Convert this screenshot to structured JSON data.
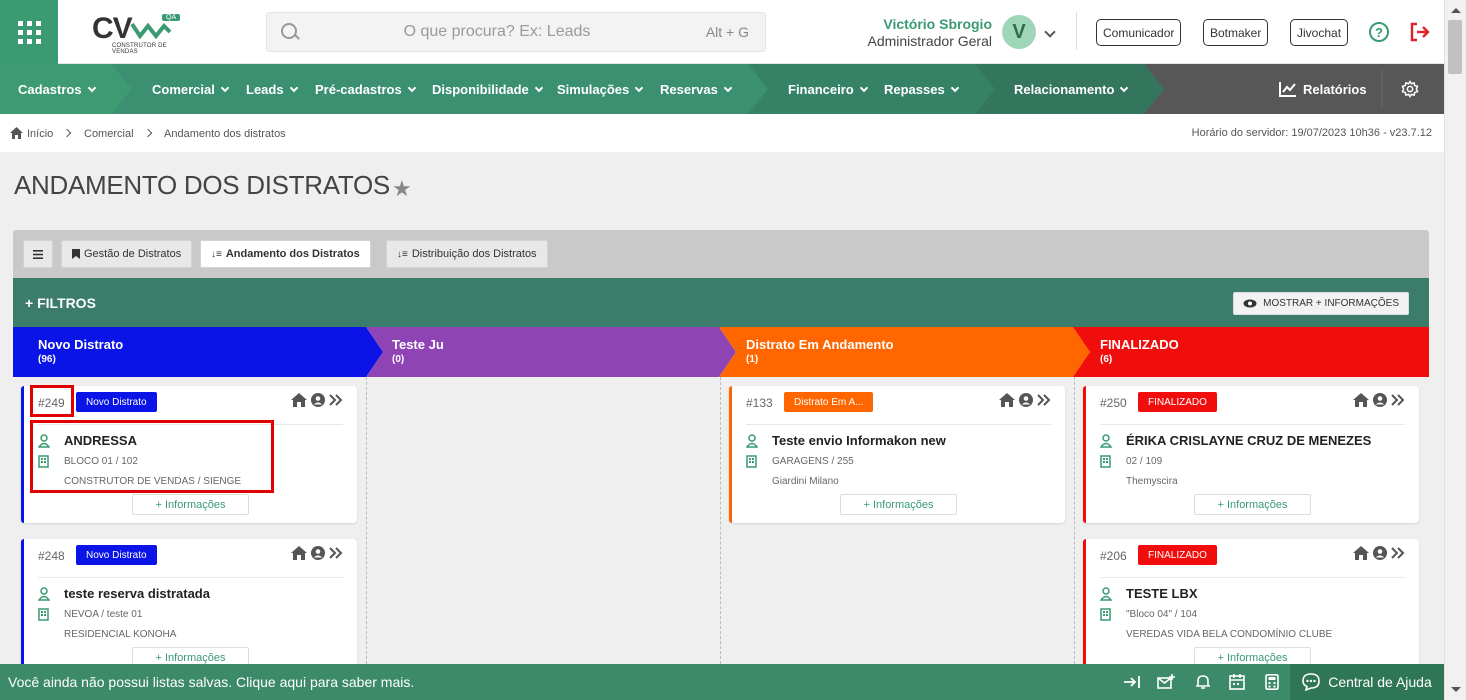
{
  "header": {
    "logo_text": "CV",
    "logo_badge": "QA",
    "logo_sub": "CONSTRUTOR DE VENDAS",
    "search_placeholder": "O que procura? Ex: Leads",
    "search_shortcut": "Alt + G",
    "user_name": "Victório Sbrogio",
    "user_role": "Administrador Geral",
    "avatar_letter": "V",
    "buttons": [
      "Comunicador",
      "Botmaker",
      "Jivochat"
    ],
    "help_symbol": "?"
  },
  "nav": {
    "items": [
      "Cadastros",
      "Comercial",
      "Leads",
      "Pré-cadastros",
      "Disponibilidade",
      "Simulações",
      "Reservas",
      "Financeiro",
      "Repasses",
      "Relacionamento"
    ],
    "reports": "Relatórios",
    "colors": {
      "seg1": "#3e9a72",
      "seg2": "#3a9070",
      "seg3": "#368266",
      "seg4": "#34765d",
      "seg5": "#575757"
    }
  },
  "breadcrumb": {
    "items": [
      "Início",
      "Comercial",
      "Andamento dos distratos"
    ],
    "server_time": "Horário do servidor: 19/07/2023 10h36 - v23.7.12"
  },
  "page": {
    "title": "ANDAMENTO DOS DISTRATOS",
    "tabs": [
      "Gestão de Distratos",
      "Andamento dos Distratos",
      "Distribuição dos Distratos"
    ],
    "active_tab": "Andamento dos Distratos",
    "filters_label": "+ FILTROS",
    "more_info": "MOSTRAR + INFORMAÇÕES"
  },
  "columns": [
    {
      "title": "Novo Distrato",
      "count": "(96)",
      "color": "#0a14e6"
    },
    {
      "title": "Teste Ju",
      "count": "(0)",
      "color": "#8e44b5"
    },
    {
      "title": "Distrato Em Andamento",
      "count": "(1)",
      "color": "#ff6600"
    },
    {
      "title": "FINALIZADO",
      "count": "(6)",
      "color": "#f20d0d"
    }
  ],
  "cards": [
    {
      "id": "#249",
      "badge": "Novo Distrato",
      "name": "ANDRESSA",
      "unit": "BLOCO 01 / 102",
      "enterprise": "CONSTRUTOR DE VENDAS / SIENGE",
      "info": "+ Informações",
      "color": "#0a14e6"
    },
    {
      "id": "#248",
      "badge": "Novo Distrato",
      "name": "teste reserva distratada",
      "unit": "NEVOA / teste 01",
      "enterprise": "RESIDENCIAL KONOHA",
      "info": "+ Informações",
      "color": "#0a14e6"
    },
    {
      "id": "#133",
      "badge": "Distrato Em A...",
      "name": "Teste envio Informakon new",
      "unit": "GARAGENS / 255",
      "enterprise": "Giardini Milano",
      "info": "+ Informações",
      "color": "#ff6600"
    },
    {
      "id": "#250",
      "badge": "FINALIZADO",
      "name": "ÉRIKA CRISLAYNE CRUZ DE MENEZES",
      "unit": "02 / 109",
      "enterprise": "Themyscira",
      "info": "+ Informações",
      "color": "#f20d0d"
    },
    {
      "id": "#206",
      "badge": "FINALIZADO",
      "name": "TESTE LBX",
      "unit": "\"Bloco 04\" / 104",
      "enterprise": "VEREDAS VIDA BELA CONDOMÍNIO CLUBE",
      "info": "+ Informações",
      "color": "#f20d0d"
    }
  ],
  "footer": {
    "message": "Você ainda não possui listas salvas. Clique aqui para saber mais.",
    "help_center": "Central de Ajuda"
  }
}
